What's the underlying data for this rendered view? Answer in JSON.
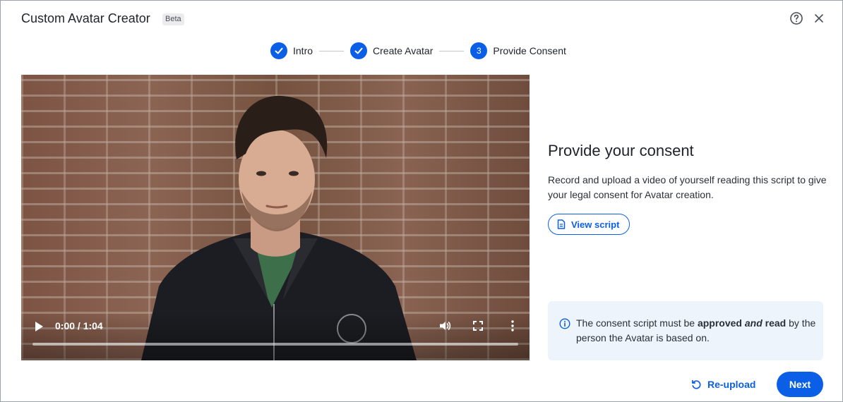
{
  "header": {
    "title": "Custom Avatar Creator",
    "badge": "Beta",
    "help_icon": "help-circle-icon",
    "close_icon": "close-icon"
  },
  "stepper": {
    "steps": [
      {
        "label": "Intro",
        "status": "complete",
        "marker": "check-icon"
      },
      {
        "label": "Create Avatar",
        "status": "complete",
        "marker": "check-icon"
      },
      {
        "label": "Provide Consent",
        "status": "current",
        "marker": "3"
      }
    ],
    "accent_color": "#0b5fe6"
  },
  "video": {
    "time": "0:00 / 1:04",
    "playing": false,
    "progress": 0
  },
  "consent": {
    "title": "Provide your consent",
    "description": "Record and upload a video of yourself reading this script to give your legal consent for Avatar creation.",
    "view_script_label": "View script"
  },
  "info": {
    "text_before": "The consent script must be ",
    "bold_1": "approved",
    "italic_bold": "and",
    "bold_2": "read",
    "text_after": " by the person the Avatar is based on."
  },
  "footer": {
    "reupload_label": "Re-upload",
    "next_label": "Next"
  }
}
